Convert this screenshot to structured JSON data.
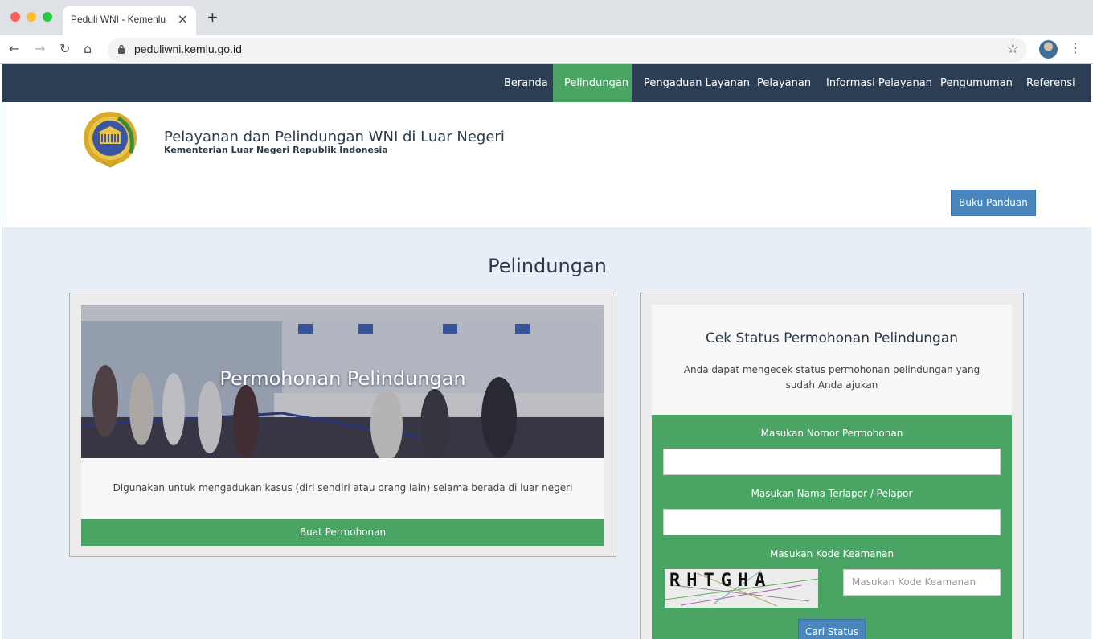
{
  "browser": {
    "tab_title": "Peduli WNI  - Kemenlu",
    "url": "peduliwni.kemlu.go.id"
  },
  "nav": {
    "items": [
      {
        "label": "Beranda"
      },
      {
        "label": "Pelindungan"
      },
      {
        "label": "Pengaduan Layanan"
      },
      {
        "label": "Pelayanan"
      },
      {
        "label": "Informasi Pelayanan"
      },
      {
        "label": "Pengumuman"
      },
      {
        "label": "Referensi"
      }
    ],
    "active": "Pelindungan",
    "active_color": "#4aa564",
    "bg_color": "#2c3e54"
  },
  "header": {
    "title": "Pelayanan dan Pelindungan WNI di Luar Negeri",
    "subtitle": "Kementerian Luar Negeri Republik Indonesia",
    "guide_button": "Buku Panduan"
  },
  "main": {
    "section_title": "Pelindungan",
    "left_card": {
      "hero_title": "Permohonan Pelindungan",
      "description": "Digunakan untuk mengadukan kasus (diri sendiri atau orang lain) selama berada di luar negeri",
      "button": "Buat Permohonan"
    },
    "right_card": {
      "title": "Cek Status Permohonan Pelindungan",
      "description": "Anda dapat mengecek status permohonan pelindungan yang sudah Anda ajukan",
      "label_number": "Masukan Nomor Permohonan",
      "label_name": "Masukan Nama Terlapor / Pelapor",
      "label_code": "Masukan Kode Keamanan",
      "captcha_text": "RHTGHA",
      "code_placeholder": "Masukan Kode Keamanan",
      "button": "Cari Status"
    }
  }
}
